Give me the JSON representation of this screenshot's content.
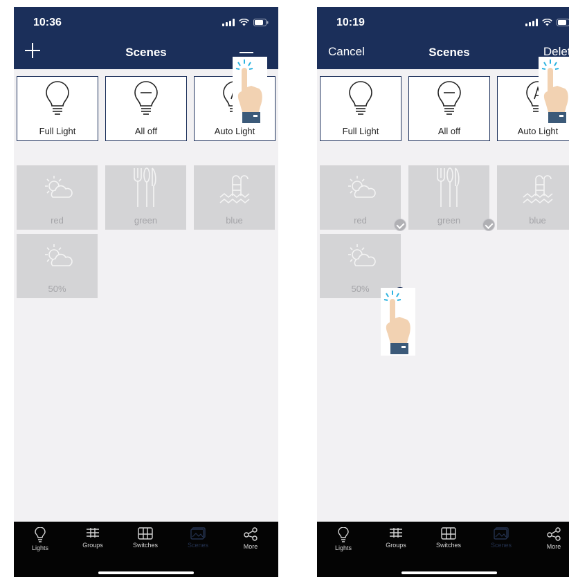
{
  "screens": [
    {
      "status": {
        "time": "10:36"
      },
      "nav": {
        "title": "Scenes",
        "left_icon": "plus-icon",
        "right_icon": "minus-icon"
      },
      "fixed_scenes": [
        {
          "label": "Full Light",
          "icon": "bulb-on-icon"
        },
        {
          "label": "All off",
          "icon": "bulb-off-icon"
        },
        {
          "label": "Auto Light",
          "icon": "auto-light-icon"
        }
      ],
      "user_scenes": [
        {
          "label": "red",
          "icon": "sun-cloud-icon"
        },
        {
          "label": "green",
          "icon": "cutlery-icon"
        },
        {
          "label": "blue",
          "icon": "pool-icon"
        },
        {
          "label": "50%",
          "icon": "sun-cloud-icon"
        }
      ],
      "tabs": [
        {
          "label": "Lights"
        },
        {
          "label": "Groups"
        },
        {
          "label": "Switches"
        },
        {
          "label": "Scenes",
          "active": true
        },
        {
          "label": "More"
        }
      ]
    },
    {
      "status": {
        "time": "10:19"
      },
      "nav": {
        "title": "Scenes",
        "left_label": "Cancel",
        "right_label": "Delete"
      },
      "fixed_scenes": [
        {
          "label": "Full Light",
          "icon": "bulb-on-icon"
        },
        {
          "label": "All off",
          "icon": "bulb-off-icon"
        },
        {
          "label": "Auto Light",
          "icon": "auto-light-icon"
        }
      ],
      "user_scenes": [
        {
          "label": "red",
          "icon": "sun-cloud-icon",
          "selected": false
        },
        {
          "label": "green",
          "icon": "cutlery-icon",
          "selected": false
        },
        {
          "label": "blue",
          "icon": "pool-icon",
          "selected": false
        },
        {
          "label": "50%",
          "icon": "sun-cloud-icon",
          "selected": true
        }
      ],
      "tabs": [
        {
          "label": "Lights"
        },
        {
          "label": "Groups"
        },
        {
          "label": "Switches"
        },
        {
          "label": "Scenes",
          "active": true
        },
        {
          "label": "More"
        }
      ]
    }
  ],
  "colors": {
    "navbar": "#1b2f5a",
    "tabbar": "#040404",
    "card_disabled": "#d4d4d6",
    "background": "#f2f1f3"
  }
}
